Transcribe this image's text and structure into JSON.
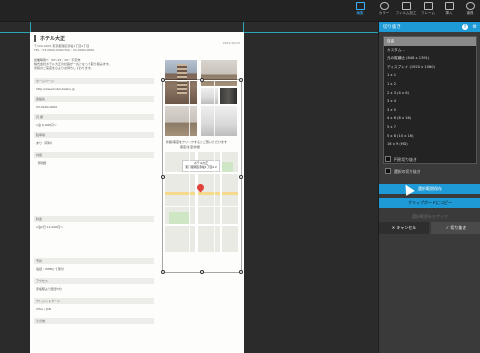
{
  "toolbar": {
    "tools_left": [
      {
        "id": "edit",
        "label": "編集",
        "active": true
      },
      {
        "id": "color",
        "label": "カラー",
        "active": false
      },
      {
        "id": "film",
        "label": "フィルム加工",
        "active": false
      },
      {
        "id": "frame",
        "label": "フレーム",
        "active": false
      }
    ],
    "tools_right": [
      {
        "id": "insert",
        "label": "挿入"
      },
      {
        "id": "tools",
        "label": "道具"
      }
    ]
  },
  "document": {
    "shop_name": "ホテル大正",
    "date": "2021/10/15",
    "address_lines": [
      "〒100-0001 東京都港区赤坂1丁目4丁目",
      "TEL : 03-0000-0000  FAX : 03-0000-0000"
    ],
    "intro_lines": [
      "営業時間7：30〜21：00・不定休",
      "株式会社ホテル大正の社員が一丸となって取り組みます。",
      "皆様のご来店を心よりお待ちしております。"
    ],
    "sections": [
      {
        "title": "ホームページ",
        "value": "http://www.hotel-taisho.jp"
      },
      {
        "title": "連絡先",
        "value": "03-0000-0000"
      },
      {
        "title": "円 額",
        "value": "1泊 6,000円〜"
      },
      {
        "title": "駐車場",
        "value": "あり（有料）"
      },
      {
        "title": "内容",
        "value": "【特徴】"
      },
      {
        "title": "料金",
        "value": "1泊2日 12,000円〜"
      },
      {
        "title": "予約",
        "value": "電話・WEBにて受付"
      },
      {
        "title": "アクセス",
        "value": "赤坂駅より徒歩5分"
      },
      {
        "title": "クレジットカード",
        "value": "VISA / JCB"
      },
      {
        "title": "その他",
        "value": ""
      }
    ],
    "photo_caption": "外観/客室をクリックするとご覧いただけます",
    "photo_sub": "客室/浴室/外観",
    "map_card_title": "ホテル大正",
    "map_card_sub": "東京都港区赤坂1丁目4-2"
  },
  "panel": {
    "title": "切り抜き",
    "help": "?",
    "settings_icon": "gear-icon",
    "ratios": [
      "自由",
      "カスタム...",
      "元の縦横比 (848 x 1391)",
      "ディスプレイ (1920 x 1080)",
      "1 x 1",
      "1 x 2",
      "2 x 3 (4 x 6)",
      "3 x 4",
      "3 x 5",
      "4 x 6 (8 x 16)",
      "5 x 7",
      "5 x 8 (10 x 16)",
      "16 x 9 (HD)"
    ],
    "selected_ratio": 0,
    "options": [
      {
        "label": "円形切り抜き",
        "checked": false
      },
      {
        "label": "選択の切り抜き",
        "checked": false
      }
    ],
    "save_label": "選択範囲保存",
    "copy_label": "クリップボードにコピー",
    "disabled_label": "選択範囲をモザイク",
    "cancel_label": "キャンセル",
    "crop_label": "切り抜き"
  },
  "colors": {
    "accent": "#1e9ad6",
    "guide": "#2aa6b8",
    "panel_bg": "#3a3a3a"
  }
}
